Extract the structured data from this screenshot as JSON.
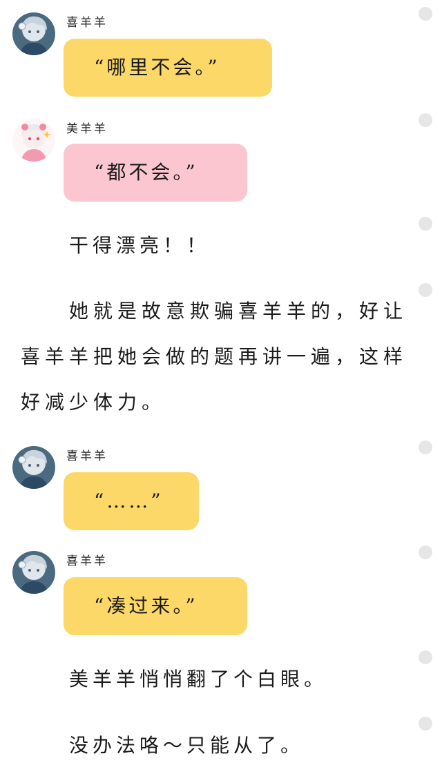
{
  "messages": [
    {
      "speaker": "喜羊羊",
      "text": "“哪里不会。”"
    },
    {
      "speaker": "美羊羊",
      "text": "“都不会。”"
    },
    {
      "speaker": "喜羊羊",
      "text": "“……”"
    },
    {
      "speaker": "喜羊羊",
      "text": "“凑过来。”"
    }
  ],
  "narration": [
    "干得漂亮！！",
    "她就是故意欺骗喜羊羊的，好让喜羊羊把她会做的题再讲一遍，这样好减少体力。",
    "美羊羊悄悄翻了个白眼。",
    "没办法咯～只能从了。"
  ],
  "avatars": {
    "xiyangyang": "boy-avatar-icon",
    "meiyangyang": "girl-avatar-icon"
  },
  "colors": {
    "bubble_xiyangyang": "#fcd868",
    "bubble_meiyangyang": "#fcc6d0",
    "reaction_dot": "#e6e6e6"
  }
}
